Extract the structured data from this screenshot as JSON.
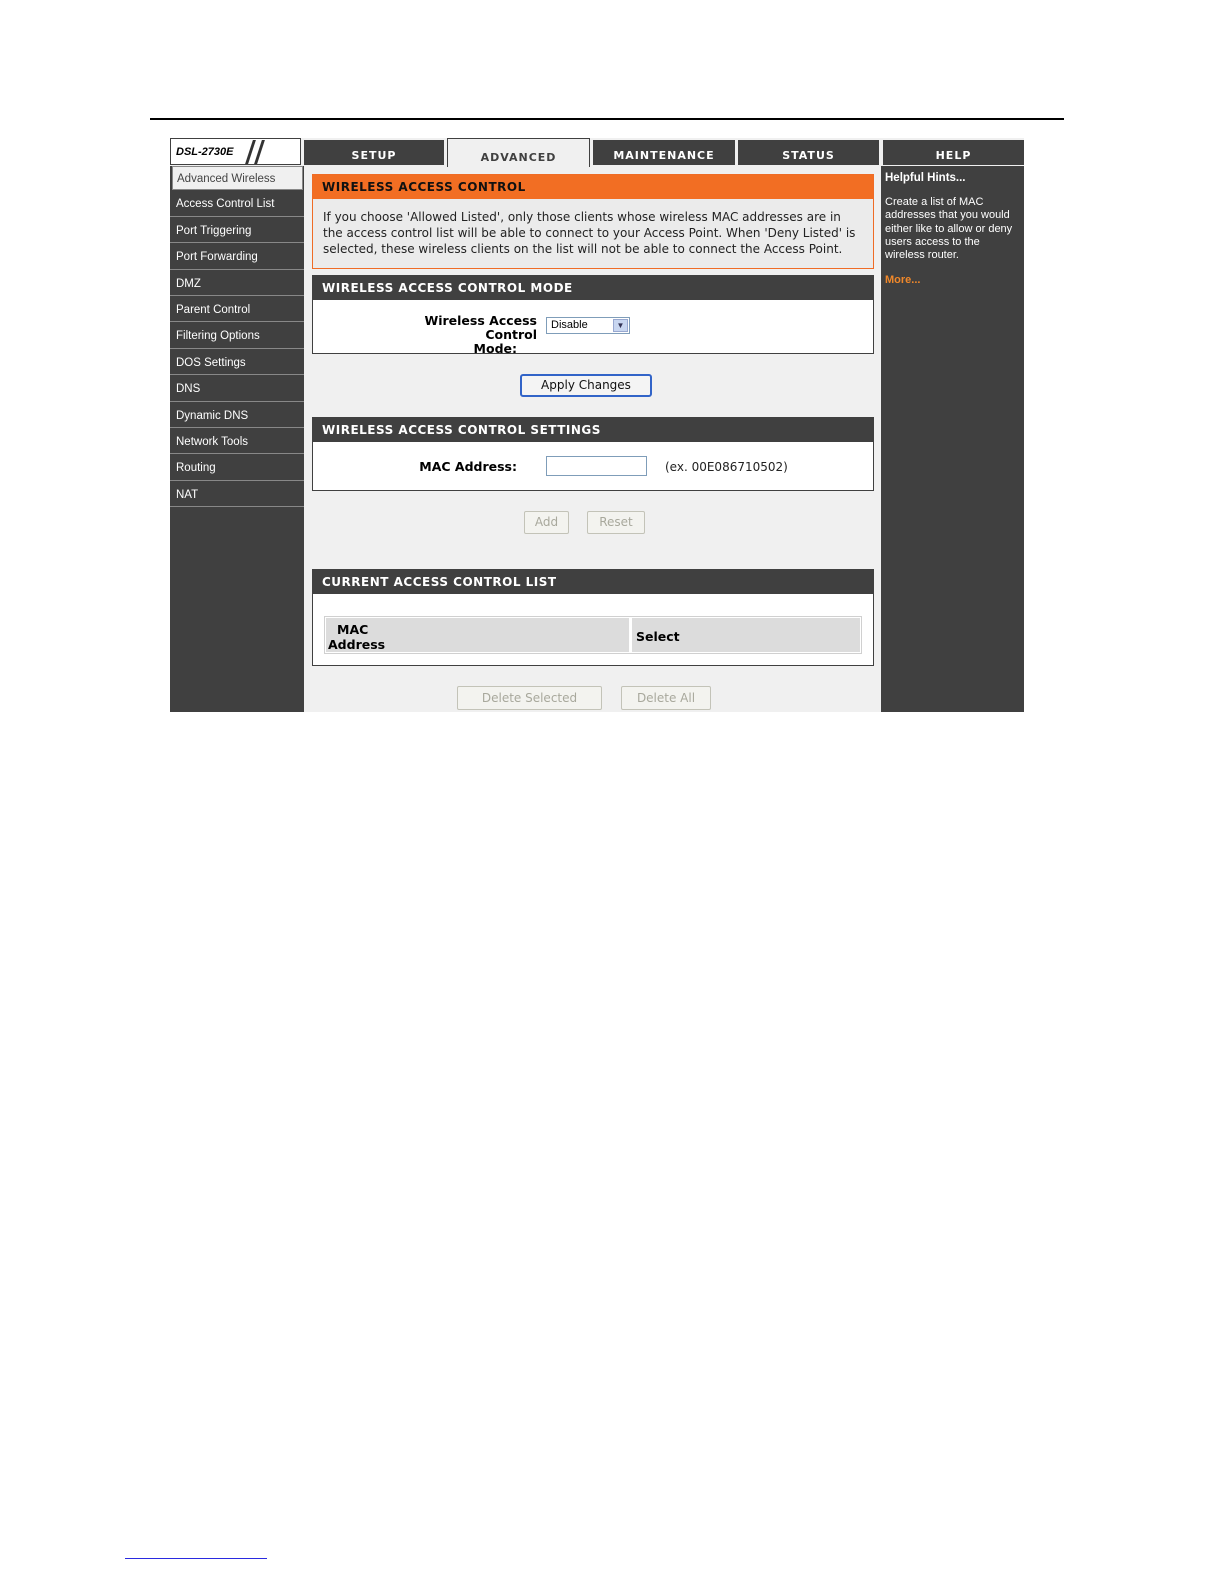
{
  "app": {
    "model": "DSL-2730E"
  },
  "tabs": [
    {
      "label": "SETUP",
      "active": false
    },
    {
      "label": "ADVANCED",
      "active": true
    },
    {
      "label": "MAINTENANCE",
      "active": false
    },
    {
      "label": "STATUS",
      "active": false
    },
    {
      "label": "HELP",
      "active": false
    }
  ],
  "sidebar": {
    "items": [
      "Advanced Wireless",
      "Access Control List",
      "Port Triggering",
      "Port Forwarding",
      "DMZ",
      "Parent Control",
      "Filtering Options",
      "DOS Settings",
      "DNS",
      "Dynamic DNS",
      "Network Tools",
      "Routing",
      "NAT"
    ],
    "active_index": 0
  },
  "intro": {
    "title": "WIRELESS ACCESS CONTROL",
    "text": "If you choose 'Allowed Listed', only those clients whose wireless MAC addresses are in the access control list will be able to connect to your Access Point. When 'Deny Listed' is selected, these wireless clients on the list will not be able to connect the Access Point."
  },
  "mode": {
    "title": "WIRELESS ACCESS CONTROL MODE",
    "label_line1": "Wireless Access Control",
    "label_line2": "Mode:",
    "selected": "Disable",
    "apply_label": "Apply Changes"
  },
  "settings": {
    "title": "WIRELESS ACCESS CONTROL SETTINGS",
    "mac_label": "MAC Address:",
    "mac_value": "",
    "mac_hint": "(ex. 00E086710502)",
    "add_label": "Add",
    "reset_label": "Reset"
  },
  "list": {
    "title": "CURRENT ACCESS CONTROL LIST",
    "col_mac_line1": "MAC",
    "col_mac_line2": "Address",
    "col_select": "Select",
    "delete_selected_label": "Delete Selected",
    "delete_all_label": "Delete All"
  },
  "help": {
    "title": "Helpful Hints...",
    "text": "Create a list of MAC addresses that you would either like to allow or deny users access to the wireless router.",
    "more": "More..."
  },
  "colors": {
    "accent_orange": "#f26e23",
    "dark_panel": "#404040",
    "primary_button_border": "#3264c8"
  }
}
